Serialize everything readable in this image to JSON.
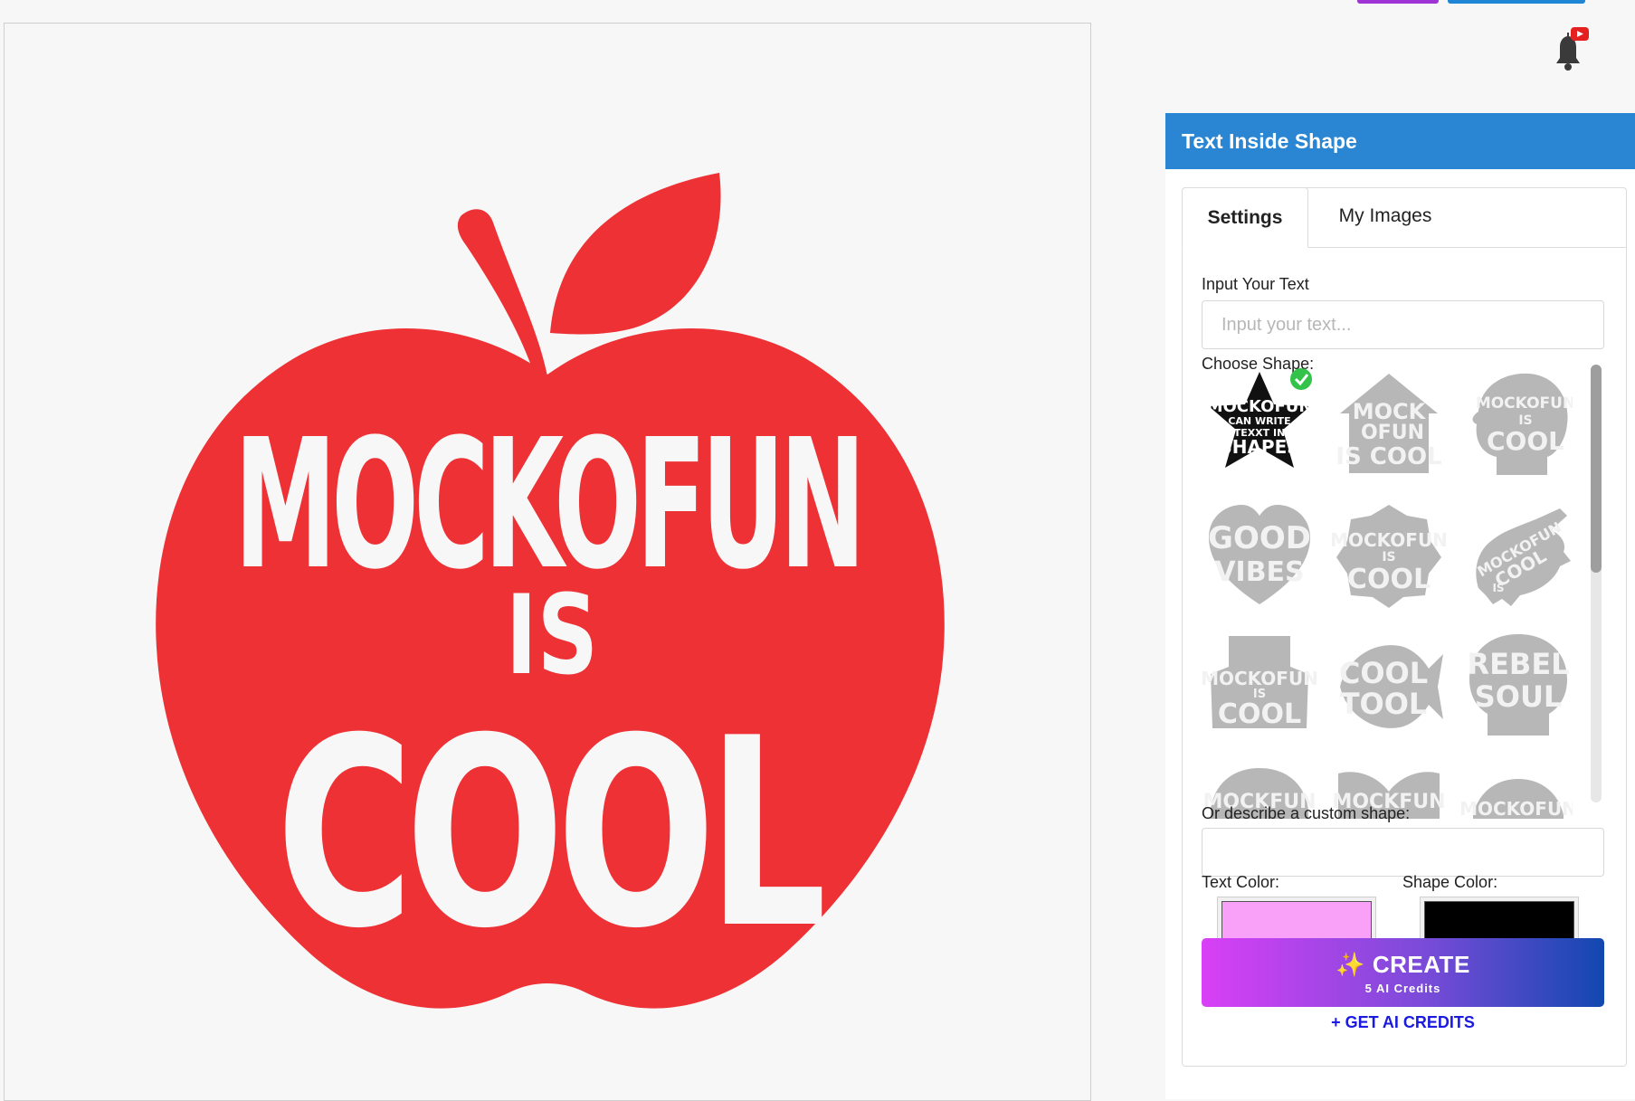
{
  "header": {
    "title": "Text Inside Shape"
  },
  "tabs": {
    "settings": "Settings",
    "my_images": "My Images"
  },
  "input_text": {
    "label": "Input Your Text",
    "placeholder": "Input your text..."
  },
  "choose_shape": {
    "label": "Choose Shape:",
    "shapes": [
      {
        "name": "star",
        "text": [
          "MOCKOFUN",
          "CAN WRITE",
          "TEXXT IN",
          "SHAPES"
        ],
        "selected": true
      },
      {
        "name": "house",
        "text": [
          "MOCK",
          "OFUN",
          "IS",
          "COOL"
        ],
        "selected": false
      },
      {
        "name": "head",
        "text": [
          "MOCKOFUN",
          "IS",
          "COOL"
        ],
        "selected": false
      },
      {
        "name": "heart",
        "text": [
          "GOOD",
          "VIBES"
        ],
        "selected": false
      },
      {
        "name": "badge",
        "text": [
          "MOCKOFUN",
          "IS",
          "COOL"
        ],
        "selected": false
      },
      {
        "name": "lizard",
        "text": [
          "MOCKOFUN",
          "COOL",
          "IS"
        ],
        "selected": false
      },
      {
        "name": "hat",
        "text": [
          "MOCKOFUN",
          "IS",
          "COOL"
        ],
        "selected": false
      },
      {
        "name": "fish",
        "text": [
          "COOL",
          "TOOL"
        ],
        "selected": false
      },
      {
        "name": "skull",
        "text": [
          "REBEL",
          "SOUL"
        ],
        "selected": false
      },
      {
        "name": "round-1",
        "text": [
          "MOCKFUN"
        ],
        "selected": false
      },
      {
        "name": "butterfly",
        "text": [
          "MOCKFUN"
        ],
        "selected": false
      },
      {
        "name": "round-2",
        "text": [
          "MOCKOFUN"
        ],
        "selected": false
      }
    ]
  },
  "custom_shape": {
    "label": "Or describe a custom shape:",
    "value": ""
  },
  "colors": {
    "text_label": "Text Color:",
    "text_value": "#f9a0f9",
    "shape_label": "Shape Color:",
    "shape_value": "#000000"
  },
  "create": {
    "icon": "sparkles-icon",
    "label": "✨ CREATE",
    "credits": "5 AI Credits"
  },
  "get_credits": "+ GET AI CREDITS",
  "canvas": {
    "words": [
      "MOCKOFUN",
      "IS",
      "COOL"
    ],
    "apple_color": "#ee3135",
    "text_color": "#f7f7f7"
  }
}
